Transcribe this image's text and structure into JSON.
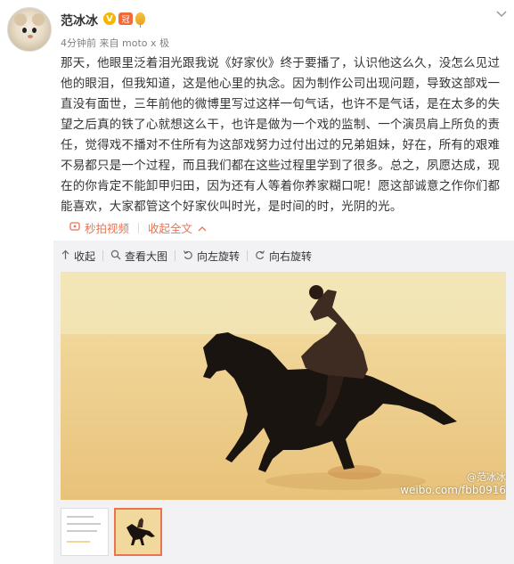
{
  "post": {
    "username": "范冰冰",
    "verified_badge": "V",
    "crown_badge": "冠",
    "time": "4分钟前",
    "source": "来自 moto x 极",
    "text": "那天，他眼里泛着泪光跟我说《好家伙》终于要播了，认识他这么久，没怎么见过他的眼泪，但我知道，这是他心里的执念。因为制作公司出现问题，导致这部戏一直没有面世，三年前他的微博里写过这样一句气话，也许不是气话，是在太多的失望之后真的铁了心就想这么干，也许是做为一个戏的监制、一个演员肩上所负的责任，觉得戏不播对不住所有为这部戏努力过付出过的兄弟姐妹，好在，所有的艰难不易都只是一个过程，而且我们都在这些过程里学到了很多。总之，夙愿达成，现在的你肯定不能卸甲归田，因为还有人等着你养家糊口呢！愿这部诚意之作你们都能喜欢，大家都管这个好家伙叫时光，是时间的时，光阴的光。"
  },
  "actions": {
    "video_label": "秒拍视频",
    "expand_label": "收起全文",
    "expand_chevron": "^"
  },
  "toolbar": {
    "collapse": "收起",
    "view_large": "查看大图",
    "rotate_left": "向左旋转",
    "rotate_right": "向右旋转"
  },
  "photo": {
    "watermark_name": "@范冰冰",
    "watermark_url": "weibo.com/fbb0916"
  },
  "icons": {
    "dropdown": "chevron-down-icon",
    "video": "video-icon",
    "collapse": "arrow-up-icon",
    "search": "search-icon",
    "rotate_left": "rotate-left-icon",
    "rotate_right": "rotate-right-icon"
  },
  "colors": {
    "accent": "#eb7350",
    "panel": "#f2f2f5",
    "verified": "#f7b500"
  }
}
